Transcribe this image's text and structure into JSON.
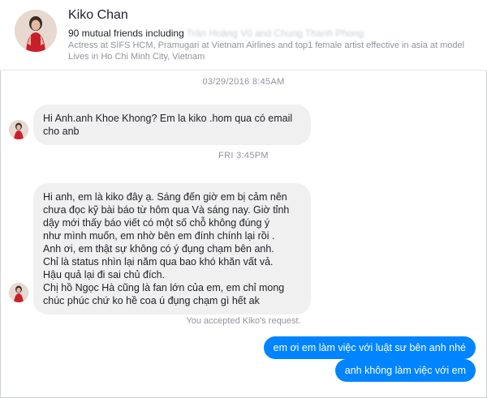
{
  "profile": {
    "name": "Kiko Chan",
    "mutual_prefix": "90 mutual friends including ",
    "mutual_names": "Trần Hoàng Vũ and Chung Thanh Phong",
    "bio": "Actress at SIFS HCM, Pramugari at Vietnam Airlines and top1 female artist effective in asia at model",
    "location": "Lives in Ho Chi Minh City, Vietnam"
  },
  "conversation": {
    "timestamp1": "03/29/2016 8:45AM",
    "msg1_lines": [
      "Hi Anh.anh Khoe Khong? Em la kiko .hom qua có email",
      "cho anb"
    ],
    "timestamp2": "FRI 3:45PM",
    "msg2_lines": [
      "Hi anh, em là kiko đây ạ. Sáng đến giờ em bị cảm nên",
      "chưa đọc kỹ bài báo từ hôm qua Và sáng nay. Giờ tỉnh",
      "dậy mới thấy báo viết có một số chỗ không đúng ý",
      "như mình muốn, em nhờ bên em đính chính lại rồi .",
      "Anh ơi, em thật sự không có ý đụng chạm bên anh.",
      "Chỉ là status nhìn lại năm qua bao khó khăn vất vả.",
      "Hậu quả lại đi sai chủ đích.",
      "Chị hồ Ngọc Hà cũng là fan lớn của em, em chỉ mong",
      "chúc phúc chứ ko hề coa ú đụng chạm gì hết ak"
    ],
    "system_note": "You accepted Kiko's request.",
    "out_msg1": "em ơi em làm việc với luật sư bên anh nhé",
    "out_msg2": "anh không làm việc với em"
  },
  "colors": {
    "outgoing": "#0084ff",
    "incoming": "#f1f0f0"
  }
}
